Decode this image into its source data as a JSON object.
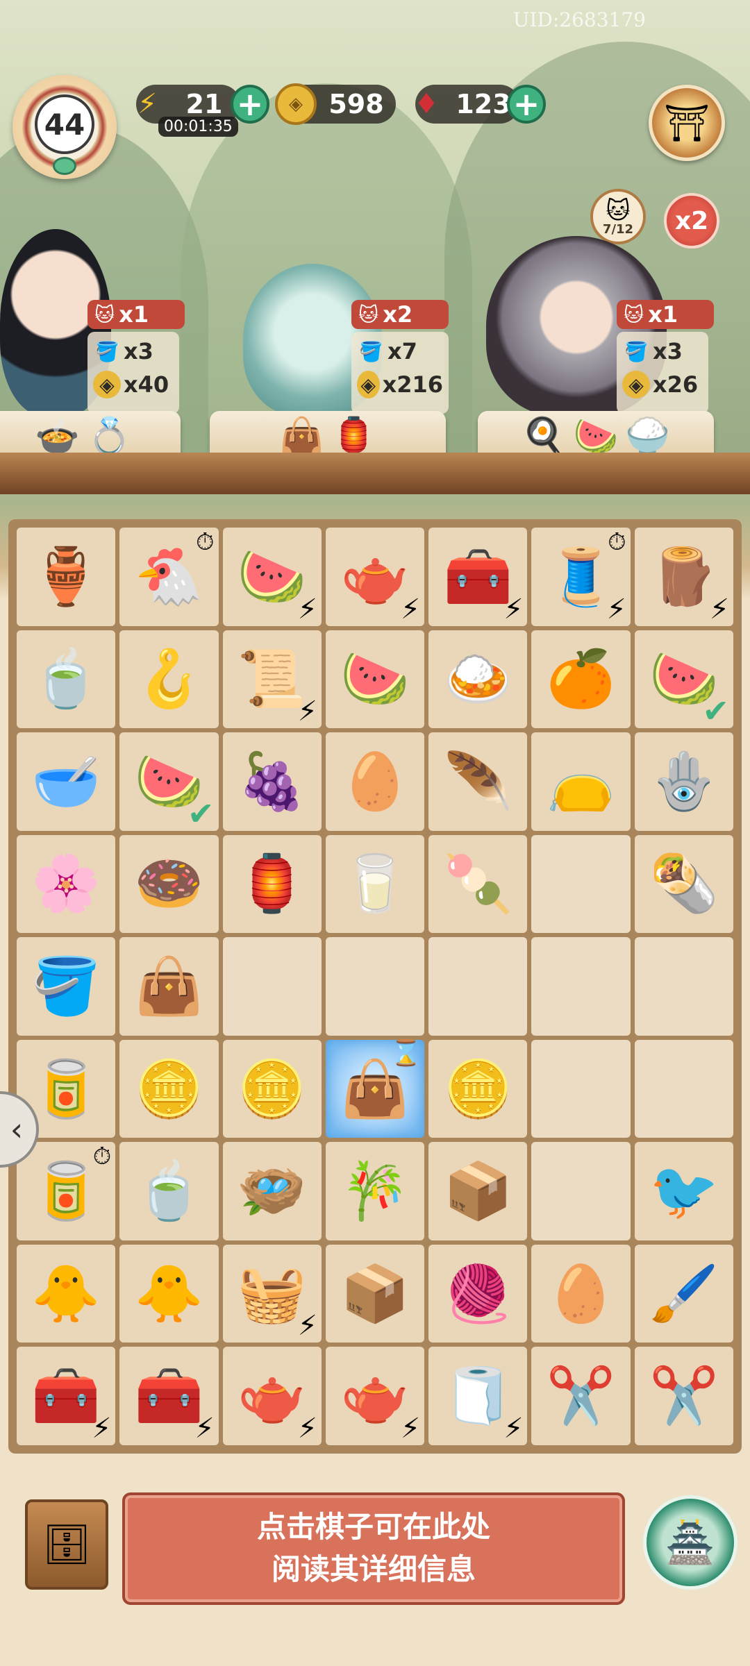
{
  "uid": "UID:2683179",
  "level": "44",
  "resources": {
    "energy": {
      "value": "21",
      "timer": "00:01:35",
      "icon": "lightning-icon"
    },
    "coins": {
      "value": "598",
      "icon": "coin-icon"
    },
    "gems": {
      "value": "123",
      "icon": "red-gem-icon"
    }
  },
  "cat_counter": "7/12",
  "multiplier": "x2",
  "customers": [
    {
      "cat_count": "x1",
      "rewards": [
        {
          "icon": "bucket-icon",
          "amount": "x3"
        },
        {
          "icon": "coin-icon",
          "amount": "x40"
        }
      ],
      "order_items": [
        "🍲",
        "💍"
      ]
    },
    {
      "cat_count": "x2",
      "rewards": [
        {
          "icon": "bucket-icon",
          "amount": "x7"
        },
        {
          "icon": "coin-icon",
          "amount": "x216"
        }
      ],
      "order_items": [
        "👜",
        "🏮"
      ]
    },
    {
      "cat_count": "x1",
      "rewards": [
        {
          "icon": "bucket-icon",
          "amount": "x3"
        },
        {
          "icon": "coin-icon",
          "amount": "x26"
        }
      ],
      "order_items": [
        "🍳",
        "🍉",
        "🍚"
      ]
    }
  ],
  "board": [
    [
      "🏺",
      "🐔",
      "🍉",
      "🫖",
      "🧰",
      "🧵",
      "🪵"
    ],
    [
      "🍵",
      "🪝",
      "📜",
      "🍉",
      "🍛",
      "🍊",
      "🍉"
    ],
    [
      "🥣",
      "🍉",
      "🍇",
      "🥚",
      "🪶",
      "👝",
      "🪬"
    ],
    [
      "🌸",
      "🍩",
      "🏮",
      "🥛",
      "🍡",
      "",
      "🌯"
    ],
    [
      "🪣",
      "👜",
      "",
      "",
      "",
      "",
      ""
    ],
    [
      "🥫",
      "🪙",
      "🪙",
      "👜",
      "🪙",
      "",
      ""
    ],
    [
      "🥫",
      "🍵",
      "🪺",
      "🎋",
      "📦",
      "",
      "🐦"
    ],
    [
      "🐥",
      "🐥",
      "🧺",
      "📦",
      "🧶",
      "🥚",
      "🖌️"
    ],
    [
      "🧰",
      "🧰",
      "🫖",
      "🫖",
      "🧻",
      "✂️",
      "✂️"
    ]
  ],
  "info_panel": {
    "line1": "点击棋子可在此处",
    "line2": "阅读其详细信息"
  },
  "colors": {
    "accent_red": "#c0493a",
    "plus_green": "#3fb27f",
    "board_frame": "#a9855b"
  }
}
